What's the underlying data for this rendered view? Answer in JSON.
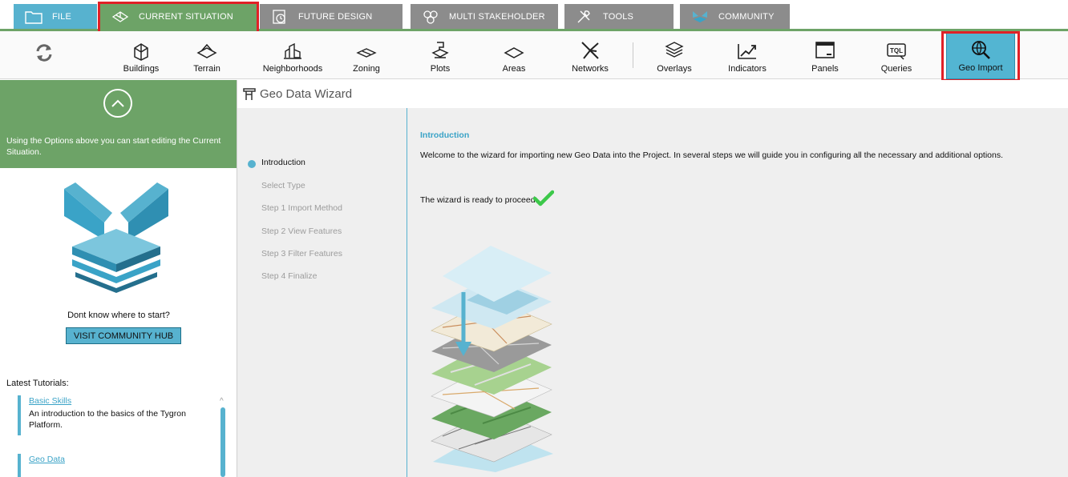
{
  "tabs": [
    {
      "label": "FILE",
      "icon": "folder-icon"
    },
    {
      "label": "CURRENT SITUATION",
      "icon": "building-outline-icon",
      "active": true
    },
    {
      "label": "FUTURE DESIGN",
      "icon": "clock-building-icon"
    },
    {
      "label": "MULTI STAKEHOLDER",
      "icon": "stakeholder-icon"
    },
    {
      "label": "TOOLS",
      "icon": "tools-icon"
    },
    {
      "label": "COMMUNITY",
      "icon": "tygron-logo-icon"
    }
  ],
  "toolbar": {
    "items": [
      {
        "label": "",
        "icon": "refresh-icon"
      },
      {
        "label": "Buildings",
        "icon": "building-icon"
      },
      {
        "label": "Terrain",
        "icon": "terrain-icon"
      },
      {
        "label": "Neighborhoods",
        "icon": "neighborhood-icon"
      },
      {
        "label": "Zoning",
        "icon": "zoning-icon"
      },
      {
        "label": "Plots",
        "icon": "plot-icon"
      },
      {
        "label": "Areas",
        "icon": "area-icon"
      },
      {
        "label": "Networks",
        "icon": "network-icon"
      },
      {
        "label": "Overlays",
        "icon": "overlay-icon"
      },
      {
        "label": "Indicators",
        "icon": "indicator-icon"
      },
      {
        "label": "Panels",
        "icon": "panel-icon"
      },
      {
        "label": "Queries",
        "icon": "query-icon"
      },
      {
        "label": "Geo Import",
        "icon": "globe-search-icon",
        "selected": true
      }
    ]
  },
  "sidebar": {
    "info": "Using the Options above you can start editing the Current Situation.",
    "dont_know": "Dont know where to start?",
    "hub_button": "VISIT COMMUNITY HUB",
    "tutorials_title": "Latest Tutorials:",
    "tutorials": [
      {
        "title": "Basic Skills",
        "text": "An introduction to the basics of the Tygron Platform."
      },
      {
        "title": "Geo Data",
        "text": ""
      }
    ]
  },
  "wizard": {
    "title": "Geo Data Wizard",
    "steps": [
      {
        "label": "Introduction",
        "current": true
      },
      {
        "label": "Select Type"
      },
      {
        "label": "Step 1 Import Method"
      },
      {
        "label": "Step 2 View Features"
      },
      {
        "label": "Step 3 Filter Features"
      },
      {
        "label": "Step 4 Finalize"
      }
    ],
    "content": {
      "title": "Introduction",
      "welcome": "Welcome to the wizard for importing new Geo Data into the Project. In several steps we will guide you in configuring all the necessary and additional options.",
      "ready": "The wizard is ready to proceed."
    }
  },
  "colors": {
    "accent_green": "#6da367",
    "accent_blue": "#57b2cf",
    "tab_grey": "#8c8c8c",
    "highlight_red": "#e02027",
    "check_green": "#3cc84a"
  }
}
